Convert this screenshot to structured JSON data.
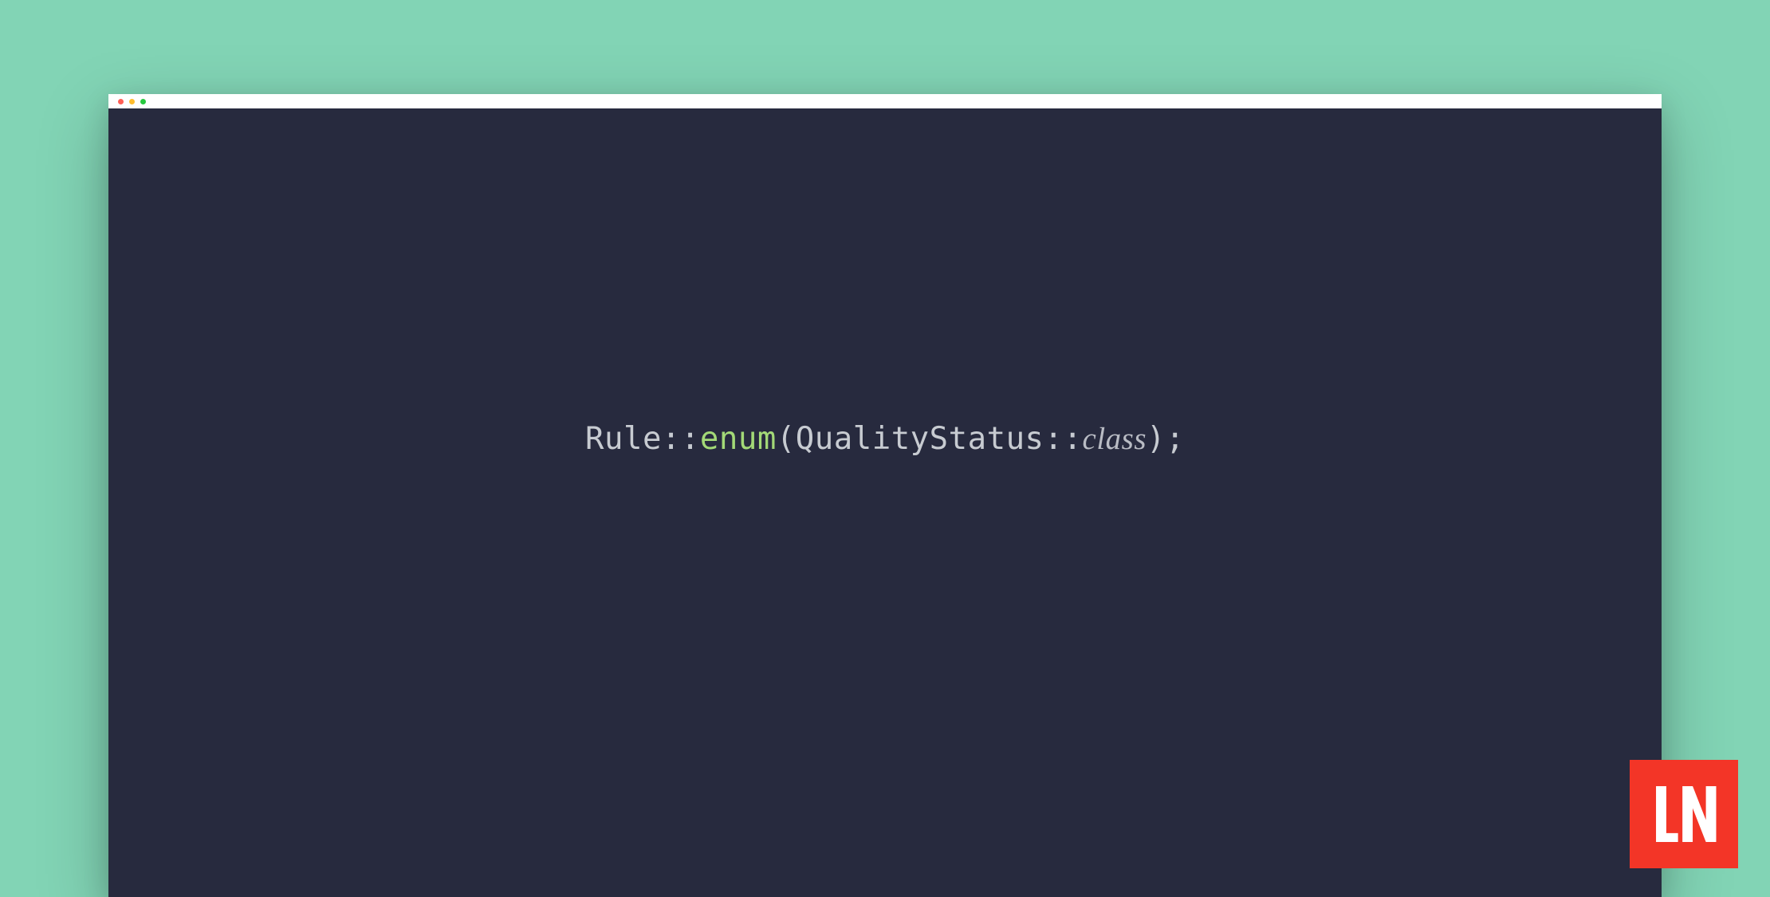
{
  "colors": {
    "background": "#82d4b5",
    "window_bg": "#272a3e",
    "titlebar_bg": "#ffffff",
    "traffic_red": "#ff5f56",
    "traffic_yellow": "#ffbd2e",
    "traffic_green": "#27c93f",
    "logo_bg": "#f33527"
  },
  "code": {
    "tokens": {
      "class_name": "Rule",
      "scope_op1": "::",
      "method": "enum",
      "paren_open": "(",
      "param_class": "QualityStatus",
      "scope_op2": "::",
      "keyword": "class",
      "paren_close": ")",
      "semi": ";"
    }
  },
  "logo": {
    "text": "LN"
  }
}
